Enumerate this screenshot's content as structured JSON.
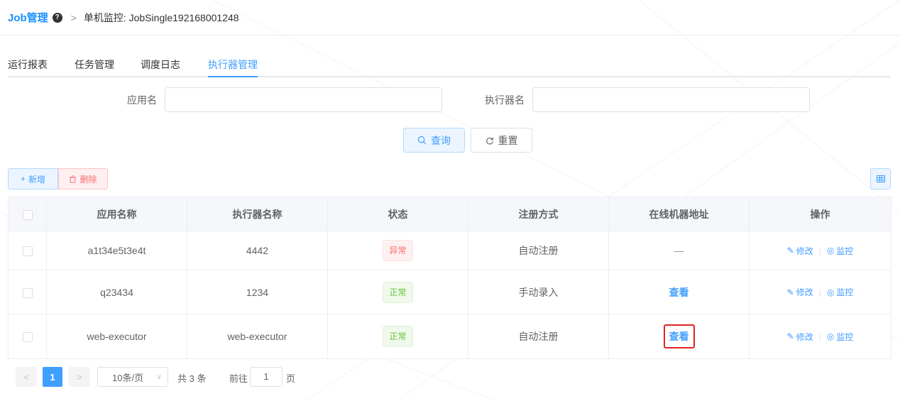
{
  "header": {
    "title": "Job管理",
    "help_icon": "question-circle-icon",
    "separator": ">",
    "breadcrumb": "单机监控: JobSingle192168001248"
  },
  "tabs": [
    {
      "label": "运行报表",
      "active": false
    },
    {
      "label": "任务管理",
      "active": false
    },
    {
      "label": "调度日志",
      "active": false
    },
    {
      "label": "执行器管理",
      "active": true
    }
  ],
  "search": {
    "app_name_label": "应用名",
    "app_name_value": "",
    "executor_name_label": "执行器名",
    "executor_name_value": "",
    "query_label": "查询",
    "reset_label": "重置"
  },
  "toolbar": {
    "add_label": "新增",
    "delete_label": "删除"
  },
  "table": {
    "columns": [
      "应用名称",
      "执行器名称",
      "状态",
      "注册方式",
      "在线机器地址",
      "操作"
    ],
    "rows": [
      {
        "app": "a1t34e5t3e4t",
        "executor": "4442",
        "status": "异常",
        "reg": "自动注册",
        "address": "—",
        "edit": "修改",
        "monitor": "监控"
      },
      {
        "app": "q23434",
        "executor": "1234",
        "status": "正常",
        "reg": "手动录入",
        "address": "查看",
        "edit": "修改",
        "monitor": "监控"
      },
      {
        "app": "web-executor",
        "executor": "web-executor",
        "status": "正常",
        "reg": "自动注册",
        "address": "查看",
        "edit": "修改",
        "monitor": "监控"
      }
    ]
  },
  "pagination": {
    "prev": "<",
    "current_page": "1",
    "next": ">",
    "page_size": "10条/页",
    "total": "共 3 条",
    "goto_label": "前往",
    "goto_value": "1",
    "page_suffix": "页"
  },
  "colors": {
    "accent": "#409eff",
    "danger": "#f56c6c",
    "success": "#67c23a",
    "highlight_box": "#e02424"
  }
}
